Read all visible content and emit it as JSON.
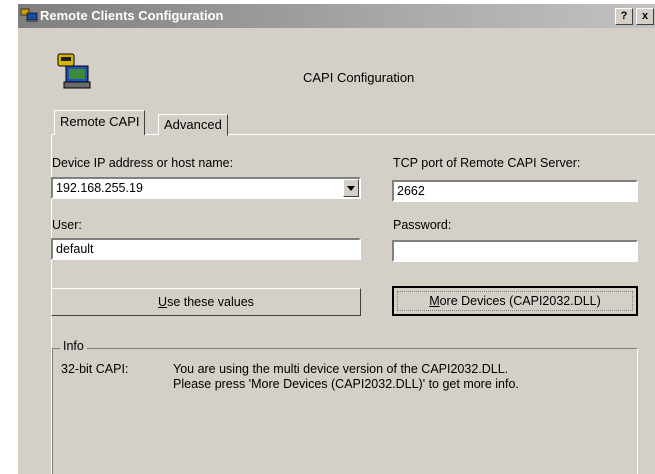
{
  "window": {
    "title": "Remote Clients Configuration",
    "help_label": "?",
    "close_label": "x"
  },
  "header": {
    "title": "CAPI Configuration"
  },
  "tabs": [
    {
      "label": "Remote CAPI",
      "active": true
    },
    {
      "label": "Advanced",
      "active": false
    }
  ],
  "form": {
    "device_label": "Device IP address or host name:",
    "device_value": "192.168.255.19",
    "tcp_label": "TCP port of Remote CAPI Server:",
    "tcp_value": "2662",
    "user_label": "User:",
    "user_value": "default",
    "password_label": "Password:",
    "password_value": ""
  },
  "buttons": {
    "use_values": {
      "accel": "U",
      "rest": "se these values"
    },
    "more_devices": {
      "accel": "M",
      "rest": "ore Devices (CAPI2032.DLL)"
    }
  },
  "info": {
    "legend": "Info",
    "key": "32-bit CAPI:",
    "line1": "You are using the multi device version of the CAPI2032.DLL.",
    "line2": "Please press 'More Devices (CAPI2032.DLL)' to get more info."
  }
}
